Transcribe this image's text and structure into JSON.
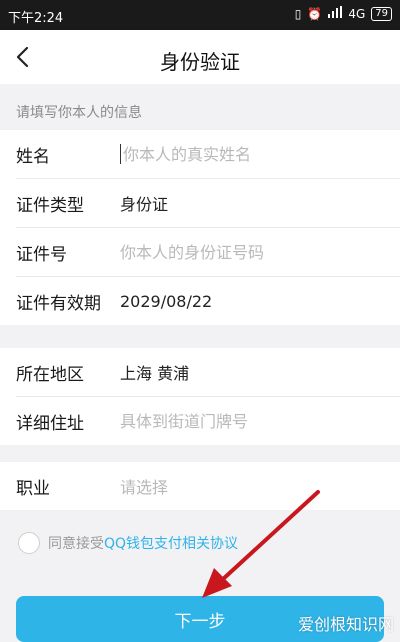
{
  "status_bar": {
    "time": "下午2:24",
    "network": "4G",
    "battery": "79"
  },
  "nav": {
    "title": "身份验证"
  },
  "section_hint": "请填写你本人的信息",
  "form": {
    "name": {
      "label": "姓名",
      "placeholder": "你本人的真实姓名"
    },
    "id_type": {
      "label": "证件类型",
      "value": "身份证"
    },
    "id_number": {
      "label": "证件号",
      "placeholder": "你本人的身份证号码"
    },
    "id_expiry": {
      "label": "证件有效期",
      "value": "2029/08/22"
    },
    "region": {
      "label": "所在地区",
      "value": "上海 黄浦"
    },
    "address": {
      "label": "详细住址",
      "placeholder": "具体到街道门牌号"
    },
    "occupation": {
      "label": "职业",
      "placeholder": "请选择"
    }
  },
  "agreement": {
    "prefix": "同意接受",
    "link": "QQ钱包支付相关协议"
  },
  "next_button": "下一步",
  "watermark": "爱创根知识网",
  "colors": {
    "accent": "#2fb4e8",
    "arrow": "#c8171d"
  }
}
